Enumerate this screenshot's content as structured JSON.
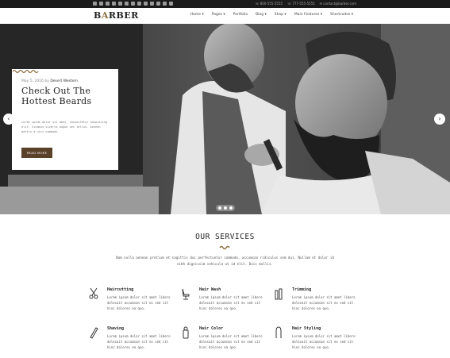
{
  "topbar": {
    "social_icons": [
      "facebook-icon",
      "twitter-icon",
      "google-plus-icon",
      "vimeo-icon",
      "linkedin-icon",
      "instagram-icon",
      "pinterest-icon",
      "youtube-icon",
      "flickr-icon",
      "tumblr-icon",
      "dribbble-icon",
      "rss-icon",
      "skype-icon"
    ],
    "phone1": "☏ 800-555-5555",
    "phone2": "☏ 777-555-5555",
    "email": "✉ contact@barber.com"
  },
  "header": {
    "logo_pre": "B",
    "logo_accent": "A",
    "logo_post": "RBER",
    "nav": [
      "Home ▾",
      "Pages ▾",
      "Portfolio",
      "Blog ▾",
      "Shop ▾",
      "Main Features ▾",
      "Shortcodes ▾"
    ]
  },
  "hero": {
    "meta_date": "May 5, 2016 by",
    "meta_author": "Desert Western",
    "title": "Check Out The Hottest Beards",
    "text": "Lorem ipsum dolor sit amet, consectetur adipiscing elit. Vivamus viverra augue nec tellus. Aenean mattis a nisi commodo.",
    "button": "READ MORE",
    "prev": "‹",
    "next": "›"
  },
  "services": {
    "title": "OUR SERVICES",
    "intro": "Nam nulla aenean pretium et sagittis dui perfectuntur commodo, accumsan ridiculus sem dui. Nullam et dolor id nibh dignissim vehicula ut id elit. Duis mollis.",
    "items": [
      {
        "title": "Haircutting",
        "icon": "scissors-icon",
        "text": "Lorem ipsum dolor sit amet libero dolecait accumsan sit ex sed sit hinc dolores ea quo."
      },
      {
        "title": "Hair Wash",
        "icon": "barber-chair-icon",
        "text": "Lorem ipsum dolor sit amet libero dolecait accumsan sit ex sed sit hinc dolores ea quo."
      },
      {
        "title": "Trimming",
        "icon": "trimmer-icon",
        "text": "Lorem ipsum dolor sit amet libero dolecait accumsan sit ex sed sit hinc dolores ea quo."
      },
      {
        "title": "Shaving",
        "icon": "razor-icon",
        "text": "Lorem ipsum dolor sit amet libero dolecait accumsan sit ex sed sit hinc dolores ea quo."
      },
      {
        "title": "Hair Color",
        "icon": "spray-bottle-icon",
        "text": "Lorem ipsum dolor sit amet libero dolecait accumsan sit ex sed sit hinc dolores ea quo."
      },
      {
        "title": "Hair Styling",
        "icon": "hair-dryer-icon",
        "text": "Lorem ipsum dolor sit amet libero dolecait accumsan sit ex sed sit hinc dolores ea quo."
      }
    ]
  },
  "colors": {
    "accent": "#8b6b3e",
    "button": "#5a4129",
    "topbar": "#1b1b1b"
  }
}
